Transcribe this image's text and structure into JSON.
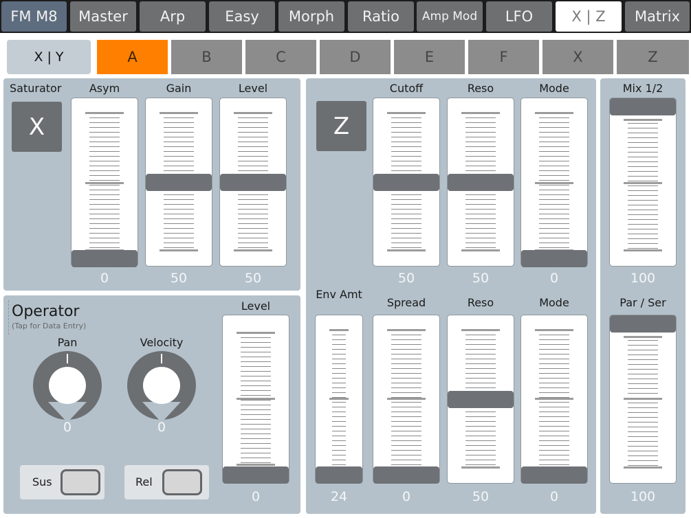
{
  "top_tabs": [
    {
      "label": "FM M8"
    },
    {
      "label": "Master"
    },
    {
      "label": "Arp"
    },
    {
      "label": "Easy"
    },
    {
      "label": "Morph"
    },
    {
      "label": "Ratio"
    },
    {
      "label": "Amp Mod"
    },
    {
      "label": "LFO"
    },
    {
      "label": "X | Z"
    },
    {
      "label": "Matrix"
    }
  ],
  "active_top_tab": "X | Z",
  "sub_tabs": [
    {
      "label": "X | Y"
    },
    {
      "label": "A"
    },
    {
      "label": "B"
    },
    {
      "label": "C"
    },
    {
      "label": "D"
    },
    {
      "label": "E"
    },
    {
      "label": "F"
    },
    {
      "label": "X"
    },
    {
      "label": "Z"
    }
  ],
  "active_sub_tab": "A",
  "saturator": {
    "label": "Saturator",
    "button": "X",
    "faders": [
      {
        "label": "Asym",
        "value": "0"
      },
      {
        "label": "Gain",
        "value": "50"
      },
      {
        "label": "Level",
        "value": "50"
      }
    ]
  },
  "operator": {
    "title": "Operator",
    "subtitle": "(Tap for Data Entry)",
    "knobs": [
      {
        "label": "Pan",
        "value": "0"
      },
      {
        "label": "Velocity",
        "value": "0"
      }
    ],
    "level": {
      "label": "Level",
      "value": "0"
    },
    "toggles": [
      {
        "label": "Sus"
      },
      {
        "label": "Rel"
      }
    ]
  },
  "filter": {
    "button": "Z",
    "top_faders": [
      {
        "label": "Cutoff",
        "value": "50"
      },
      {
        "label": "Reso",
        "value": "50"
      },
      {
        "label": "Mode",
        "value": "0"
      }
    ],
    "bottom_faders": [
      {
        "label": "Env Amt",
        "value": "24"
      },
      {
        "label": "Spread",
        "value": "0"
      },
      {
        "label": "Reso",
        "value": "50"
      },
      {
        "label": "Mode",
        "value": "0"
      }
    ]
  },
  "mix": {
    "mix12": {
      "label": "Mix 1/2",
      "value": "100"
    },
    "parser": {
      "label": "Par / Ser",
      "value": "100"
    }
  },
  "colors": {
    "accent": "#ff8000",
    "panel": "#b4c1ca",
    "handle": "#6e7175"
  }
}
